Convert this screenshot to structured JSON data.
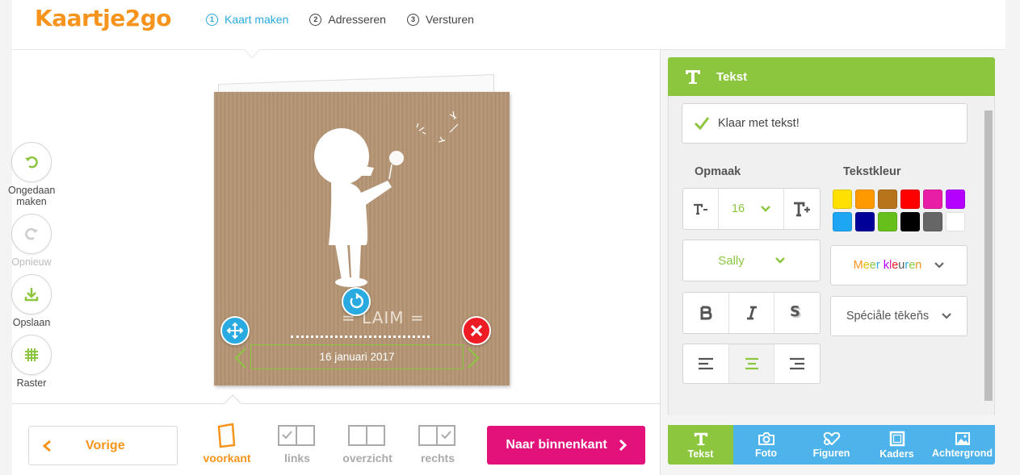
{
  "brand": {
    "logo_text": "Kaartje2go",
    "primary_color": "#f7941d",
    "accent_color": "#8cc63f",
    "info_color": "#29aae1",
    "cta_color": "#e2127a"
  },
  "steps": [
    {
      "number": "1",
      "label": "Kaart maken",
      "active": true
    },
    {
      "number": "2",
      "label": "Adresseren",
      "active": false
    },
    {
      "number": "3",
      "label": "Versturen",
      "active": false
    }
  ],
  "tools": {
    "undo_label": "Ongedaan maken",
    "redo_label": "Opnieuw",
    "save_label": "Opslaan",
    "grid_label": "Raster"
  },
  "card": {
    "name_text": "= LAIM =",
    "date_text": "16 januari 2017"
  },
  "nav": {
    "prev_label": "Vorige",
    "next_label": "Naar binnenkant",
    "views": [
      {
        "label": "voorkant",
        "active": true
      },
      {
        "label": "links",
        "active": false
      },
      {
        "label": "overzicht",
        "active": false
      },
      {
        "label": "rechts",
        "active": false
      }
    ]
  },
  "panel": {
    "title": "Tekst",
    "done_label": "Klaar met tekst!",
    "format_title": "Opmaak",
    "color_title": "Tekstkleur",
    "font_size": "16",
    "font_name": "Sally",
    "more_colors_label": "Meer kleuren",
    "special_chars_label": "Spéciåle tēkeňs",
    "swatches": [
      "#ffe000",
      "#ff9900",
      "#b8741a",
      "#ff0000",
      "#e91ea7",
      "#b300ff",
      "#1ea6f5",
      "#000099",
      "#66c01a",
      "#000000",
      "#666666",
      "#ffffff"
    ]
  },
  "tabs": [
    {
      "label": "Tekst",
      "icon": "text-icon",
      "active": true
    },
    {
      "label": "Foto",
      "icon": "camera-icon",
      "active": false
    },
    {
      "label": "Figuren",
      "icon": "shapes-icon",
      "active": false
    },
    {
      "label": "Kaders",
      "icon": "frame-icon",
      "active": false
    },
    {
      "label": "Achtergrond",
      "icon": "image-icon",
      "active": false
    }
  ]
}
